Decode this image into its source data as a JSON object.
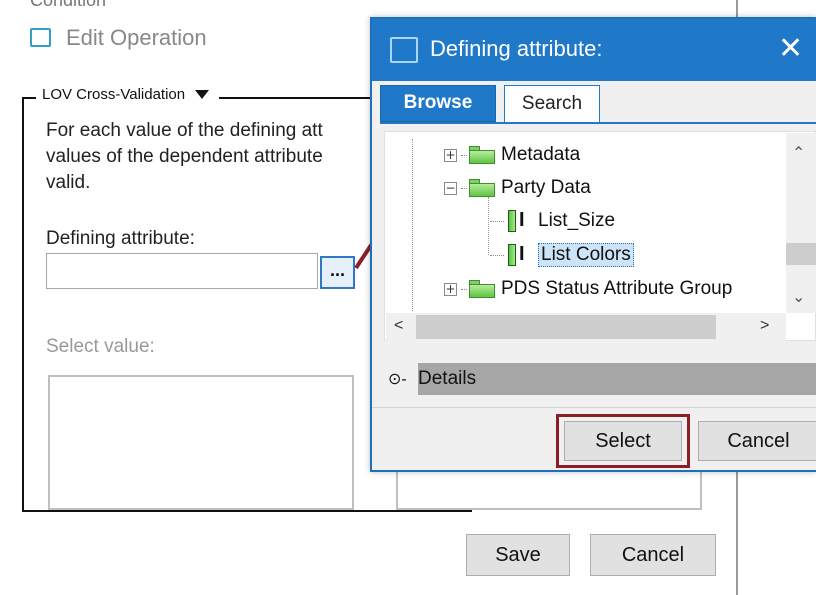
{
  "edit_window": {
    "top_cut_text": "Condition",
    "title": "Edit Operation",
    "group_label": "LOV Cross-Validation",
    "description": "For each value of the defining att\nvalues of the dependent attribute\nvalid.",
    "defining_attribute_label": "Defining attribute:",
    "defining_attribute_value": "",
    "ellipsis_label": "...",
    "select_value_label": "Select value:",
    "save_label": "Save",
    "cancel_label": "Cancel"
  },
  "dialog": {
    "title": "Defining attribute:",
    "close_label": "✕",
    "tabs": [
      {
        "label": "Browse",
        "active": true
      },
      {
        "label": "Search",
        "active": false
      }
    ],
    "tree": [
      {
        "label": "Metadata",
        "type": "folder",
        "expander": "+"
      },
      {
        "label": "Party Data",
        "type": "folder",
        "expander": "−"
      },
      {
        "label": "List_Size",
        "type": "attribute"
      },
      {
        "label": "List Colors",
        "type": "attribute",
        "selected": true
      },
      {
        "label": "PDS Status Attribute Group",
        "type": "folder",
        "expander": "+"
      }
    ],
    "details_label": "Details",
    "details_icon": "⊙-",
    "select_label": "Select",
    "cancel_label": "Cancel"
  },
  "colors": {
    "titlebar": "#1f78c8",
    "annotation": "#8b1e26",
    "folder_green": "#5fc441"
  }
}
